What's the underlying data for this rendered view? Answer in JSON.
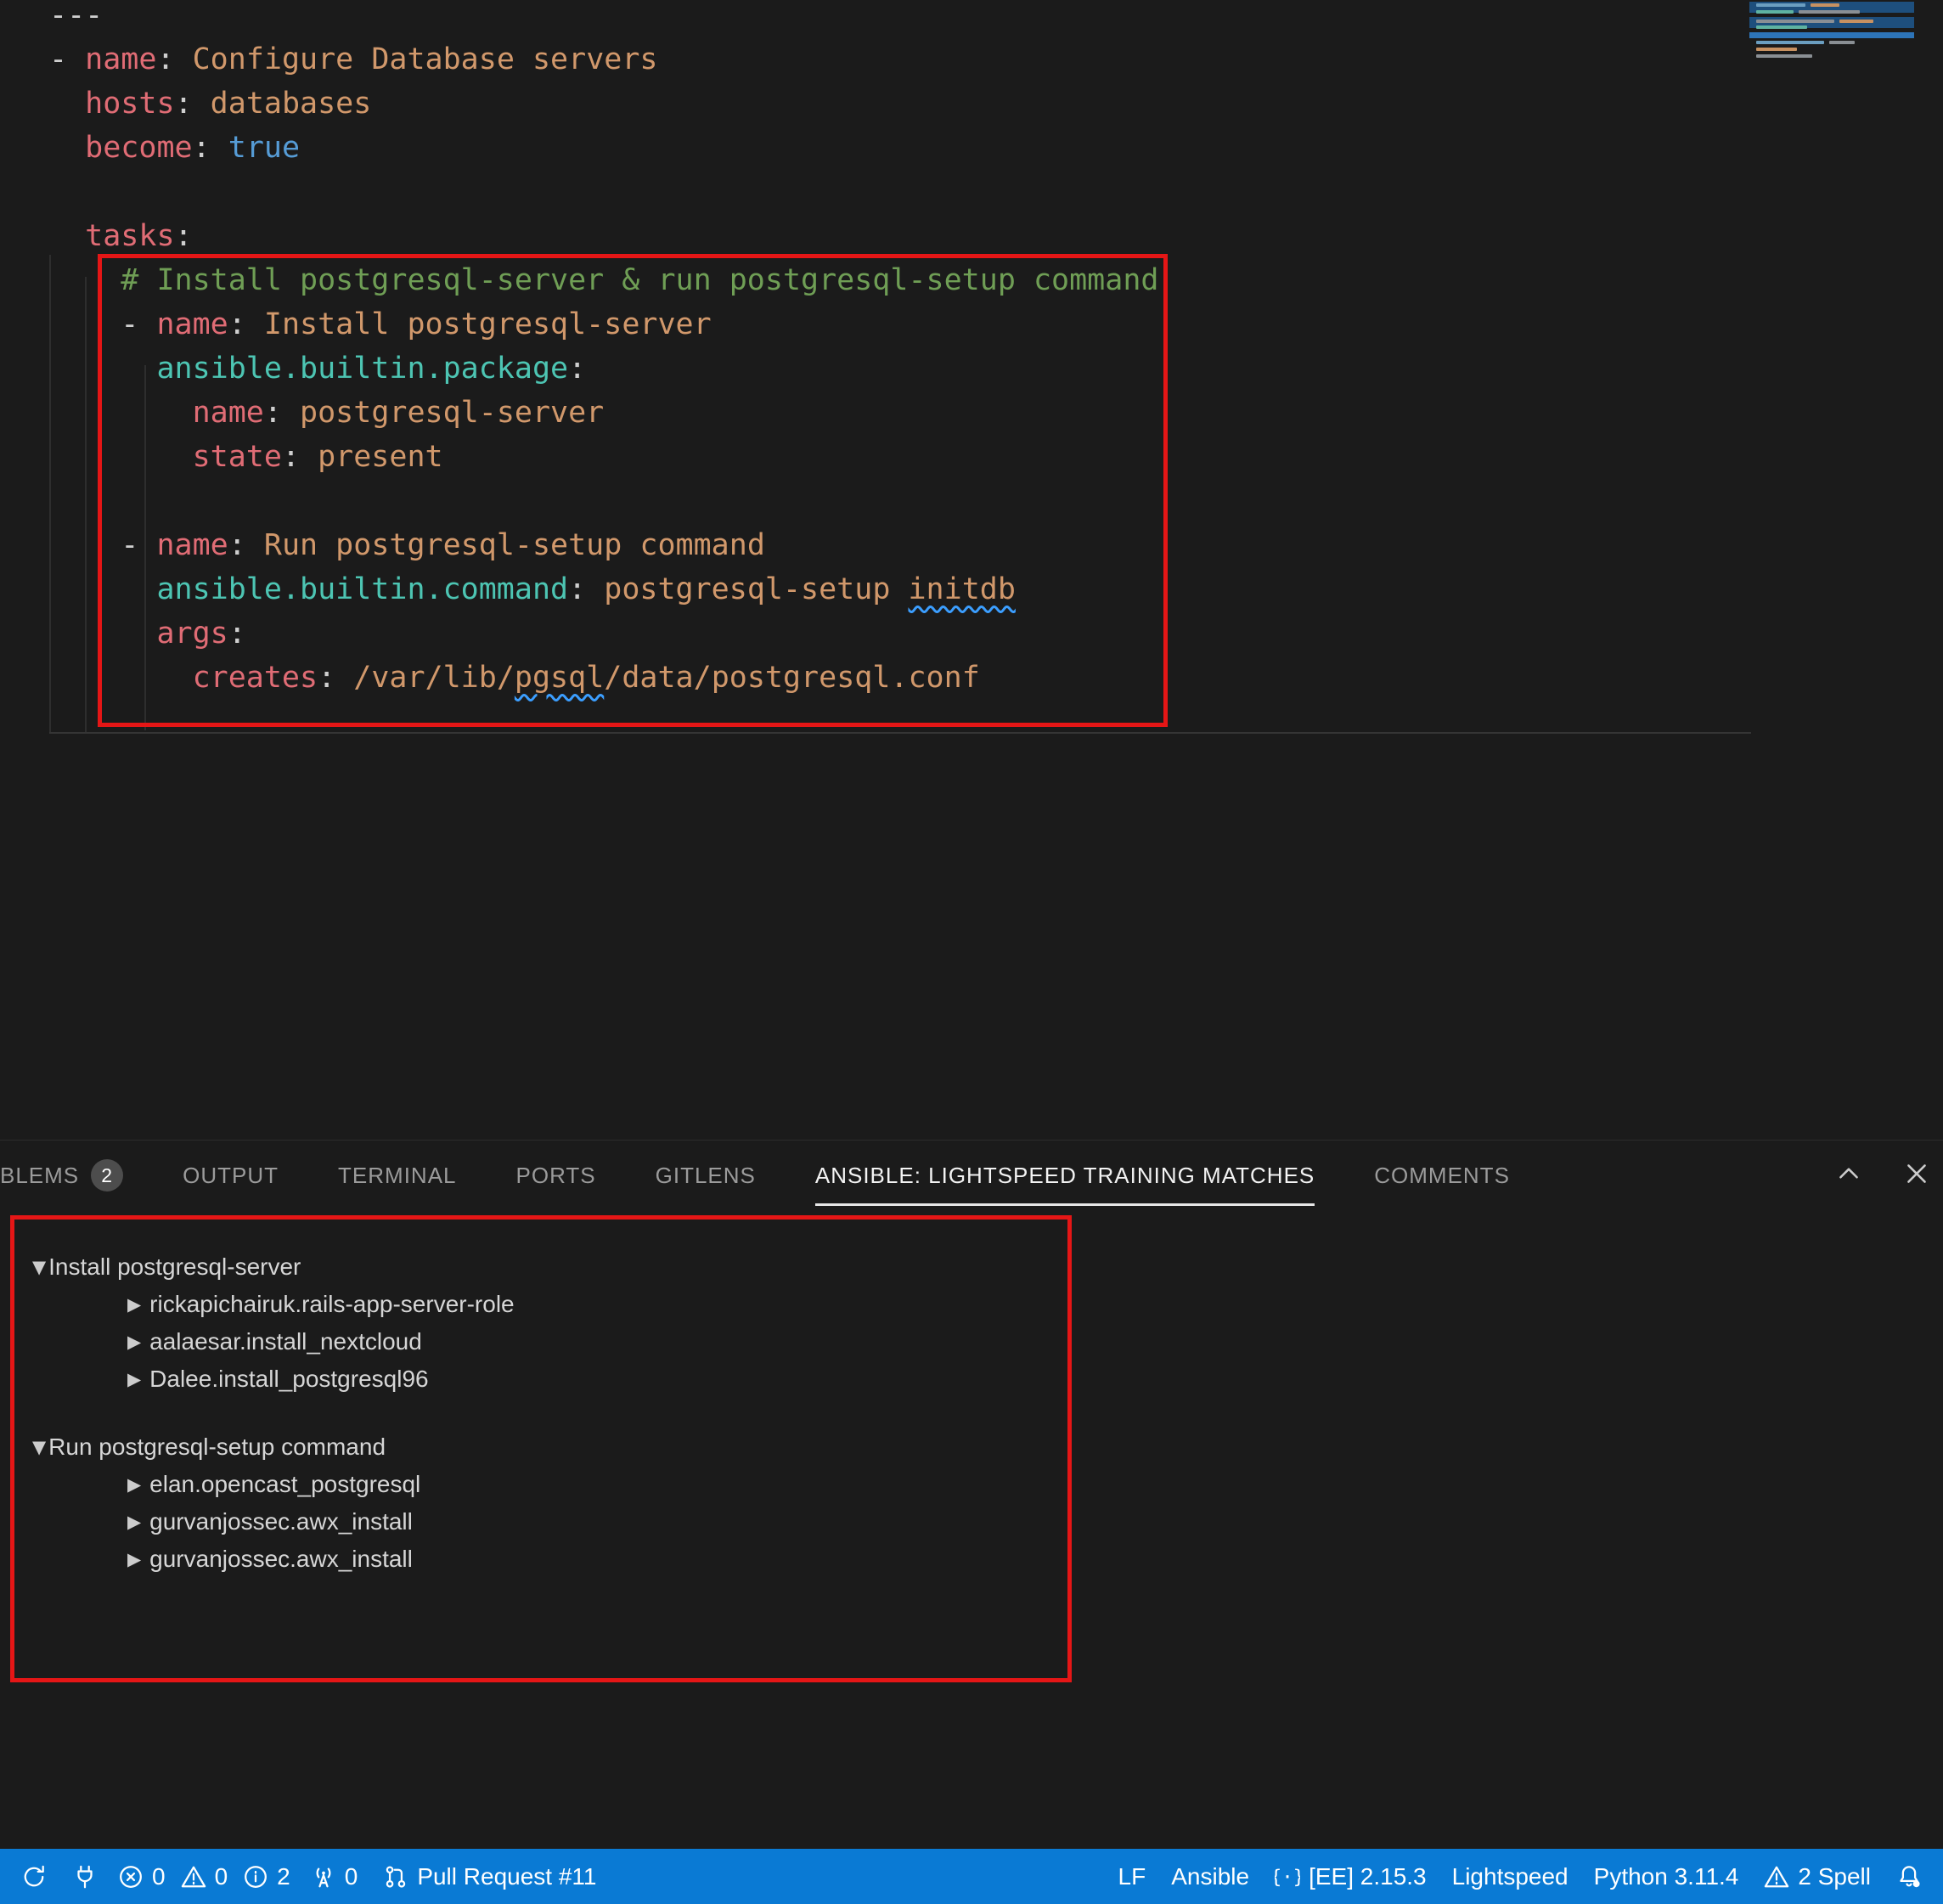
{
  "colors": {
    "annotation": "#e51616",
    "editor_background": "#1b1b1b",
    "status_bar_background": "#0a7ad4",
    "yaml_key": "#e06c75",
    "yaml_string": "#d1986b",
    "yaml_boolean": "#569cd6",
    "yaml_comment": "#6f9e55",
    "ansible_module": "#4dc5b3",
    "spell_squiggle": "#3b9eff",
    "active_tab_underline": "#e7e7e7",
    "badge_background": "#4d4d4d"
  },
  "editor": {
    "language": "yaml",
    "lines": [
      [
        {
          "t": "---",
          "c": "punct"
        }
      ],
      [
        {
          "t": "- ",
          "c": "punct"
        },
        {
          "t": "name",
          "c": "key"
        },
        {
          "t": ": ",
          "c": "punct"
        },
        {
          "t": "Configure Database servers",
          "c": "str"
        }
      ],
      [
        {
          "t": "  ",
          "c": "ws"
        },
        {
          "t": "hosts",
          "c": "key"
        },
        {
          "t": ": ",
          "c": "punct"
        },
        {
          "t": "databases",
          "c": "str"
        }
      ],
      [
        {
          "t": "  ",
          "c": "ws"
        },
        {
          "t": "become",
          "c": "key"
        },
        {
          "t": ": ",
          "c": "punct"
        },
        {
          "t": "true",
          "c": "bool"
        }
      ],
      [],
      [
        {
          "t": "  ",
          "c": "ws"
        },
        {
          "t": "tasks",
          "c": "key"
        },
        {
          "t": ":",
          "c": "punct"
        }
      ],
      [
        {
          "t": "    ",
          "c": "ws"
        },
        {
          "t": "# Install postgresql-server & run postgresql-setup command",
          "c": "comment"
        }
      ],
      [
        {
          "t": "    - ",
          "c": "punct"
        },
        {
          "t": "name",
          "c": "key"
        },
        {
          "t": ": ",
          "c": "punct"
        },
        {
          "t": "Install postgresql-server",
          "c": "str"
        }
      ],
      [
        {
          "t": "      ",
          "c": "ws"
        },
        {
          "t": "ansible.builtin.package",
          "c": "module"
        },
        {
          "t": ":",
          "c": "punct"
        }
      ],
      [
        {
          "t": "        ",
          "c": "ws"
        },
        {
          "t": "name",
          "c": "key"
        },
        {
          "t": ": ",
          "c": "punct"
        },
        {
          "t": "postgresql-server",
          "c": "str"
        }
      ],
      [
        {
          "t": "        ",
          "c": "ws"
        },
        {
          "t": "state",
          "c": "key"
        },
        {
          "t": ": ",
          "c": "punct"
        },
        {
          "t": "present",
          "c": "str"
        }
      ],
      [],
      [
        {
          "t": "    - ",
          "c": "punct"
        },
        {
          "t": "name",
          "c": "key"
        },
        {
          "t": ": ",
          "c": "punct"
        },
        {
          "t": "Run postgresql-setup command",
          "c": "str"
        }
      ],
      [
        {
          "t": "      ",
          "c": "ws"
        },
        {
          "t": "ansible.builtin.command",
          "c": "module"
        },
        {
          "t": ": ",
          "c": "punct"
        },
        {
          "t": "postgresql-setup ",
          "c": "str"
        },
        {
          "t": "initdb",
          "c": "str",
          "u": true
        }
      ],
      [
        {
          "t": "      ",
          "c": "ws"
        },
        {
          "t": "args",
          "c": "key"
        },
        {
          "t": ":",
          "c": "punct"
        }
      ],
      [
        {
          "t": "        ",
          "c": "ws"
        },
        {
          "t": "creates",
          "c": "key"
        },
        {
          "t": ": ",
          "c": "punct"
        },
        {
          "t": "/var/lib/",
          "c": "str"
        },
        {
          "t": "pgsql",
          "c": "str",
          "u": true
        },
        {
          "t": "/data/postgresql.conf",
          "c": "str"
        }
      ]
    ],
    "misspelled_words": [
      "initdb",
      "pgsql"
    ]
  },
  "panel": {
    "tabs": [
      {
        "id": "problems",
        "label": "BLEMS",
        "badge": "2",
        "active": false
      },
      {
        "id": "output",
        "label": "OUTPUT",
        "active": false
      },
      {
        "id": "terminal",
        "label": "TERMINAL",
        "active": false
      },
      {
        "id": "ports",
        "label": "PORTS",
        "active": false
      },
      {
        "id": "gitlens",
        "label": "GITLENS",
        "active": false
      },
      {
        "id": "lightspeed-matches",
        "label": "ANSIBLE: LIGHTSPEED TRAINING MATCHES",
        "active": true
      },
      {
        "id": "comments",
        "label": "COMMENTS",
        "active": false
      }
    ],
    "actions": [
      {
        "name": "maximize-panel-button",
        "icon": "chevron-up-icon"
      },
      {
        "name": "close-panel-button",
        "icon": "close-icon"
      }
    ],
    "tree": [
      {
        "label": "Install postgresql-server",
        "expanded": true,
        "children": [
          "rickapichairuk.rails-app-server-role",
          "aalaesar.install_nextcloud",
          "Dalee.install_postgresql96"
        ]
      },
      {
        "label": "Run postgresql-setup command",
        "expanded": true,
        "children": [
          "elan.opencast_postgresql",
          "gurvanjossec.awx_install",
          "gurvanjossec.awx_install"
        ]
      }
    ]
  },
  "status_bar": {
    "left": [
      {
        "name": "sync-indicator",
        "icon": "sync-icon"
      },
      {
        "name": "plug-indicator",
        "icon": "plug-icon"
      },
      {
        "name": "problems-errors",
        "icon": "error-icon",
        "text": "0",
        "tight": true
      },
      {
        "name": "problems-warnings",
        "icon": "warning-icon",
        "text": "0",
        "tight": true
      },
      {
        "name": "problems-info",
        "icon": "info-icon",
        "text": "2",
        "tight": true
      },
      {
        "name": "ports-indicator",
        "icon": "radio-tower-icon",
        "text": "0"
      },
      {
        "name": "pull-request-indicator",
        "icon": "git-pull-request-icon",
        "text": "Pull Request #11"
      }
    ],
    "right": [
      {
        "name": "eol-indicator",
        "text": "LF"
      },
      {
        "name": "language-indicator",
        "text": "Ansible"
      },
      {
        "name": "execution-environment-indicator",
        "icon": "braces-icon",
        "text": "[EE] 2.15.3"
      },
      {
        "name": "lightspeed-indicator",
        "text": "Lightspeed"
      },
      {
        "name": "python-version-indicator",
        "text": "Python 3.11.4"
      },
      {
        "name": "spell-checker-indicator",
        "icon": "warning-icon",
        "text": "2 Spell"
      },
      {
        "name": "notifications-bell",
        "icon": "bell-icon"
      }
    ]
  }
}
